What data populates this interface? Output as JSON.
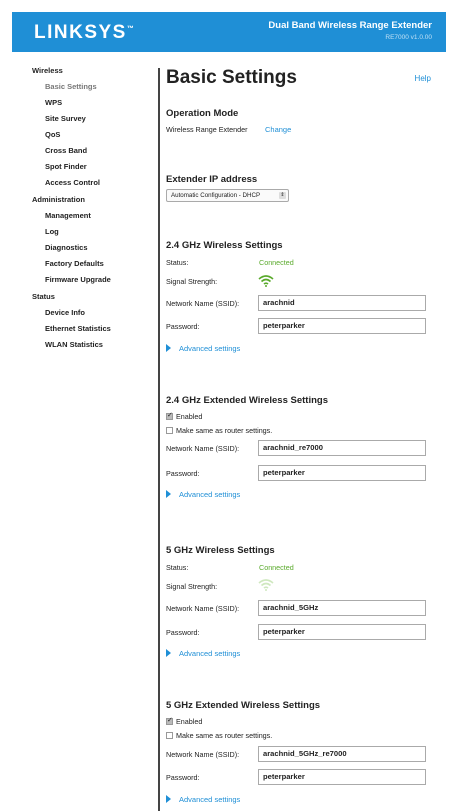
{
  "header": {
    "brand": "LINKSYS",
    "trademark": "™",
    "product": "Dual Band Wireless Range Extender",
    "firmware": "RE7000 v1.0.00"
  },
  "sidebar": {
    "sections": [
      {
        "label": "Wireless",
        "items": [
          "Basic Settings",
          "WPS",
          "Site Survey",
          "QoS",
          "Cross Band",
          "Spot Finder",
          "Access Control"
        ]
      },
      {
        "label": "Administration",
        "items": [
          "Management",
          "Log",
          "Diagnostics",
          "Factory Defaults",
          "Firmware Upgrade"
        ]
      },
      {
        "label": "Status",
        "items": [
          "Device Info",
          "Ethernet Statistics",
          "WLAN Statistics"
        ]
      }
    ],
    "active": "Basic Settings"
  },
  "main": {
    "title": "Basic Settings",
    "help": "Help",
    "operation_mode": {
      "heading": "Operation Mode",
      "value": "Wireless Range Extender",
      "change": "Change"
    },
    "ip": {
      "heading": "Extender IP address",
      "selected": "Automatic Configuration - DHCP"
    },
    "labels": {
      "status": "Status:",
      "signal": "Signal Strength:",
      "ssid": "Network Name (SSID):",
      "password": "Password:",
      "advanced": "Advanced settings",
      "enabled": "Enabled",
      "same_as_router": "Make same as router settings."
    },
    "w24": {
      "heading": "2.4 GHz Wireless Settings",
      "status": "Connected",
      "ssid": "arachnid",
      "password": "peterparker"
    },
    "w24ext": {
      "heading": "2.4 GHz Extended Wireless Settings",
      "ssid": "arachnid_re7000",
      "password": "peterparker"
    },
    "w5": {
      "heading": "5 GHz Wireless Settings",
      "status": "Connected",
      "ssid": "arachnid_5GHz",
      "password": "peterparker"
    },
    "w5ext": {
      "heading": "5 GHz Extended Wireless Settings",
      "ssid": "arachnid_5GHz_re7000",
      "password": "peterparker"
    }
  },
  "colors": {
    "brand_blue": "#1f8fd6",
    "connected_green": "#5aaa2c",
    "signal_strong": "#5aaa2c",
    "signal_weak": "#cfe8bf"
  }
}
